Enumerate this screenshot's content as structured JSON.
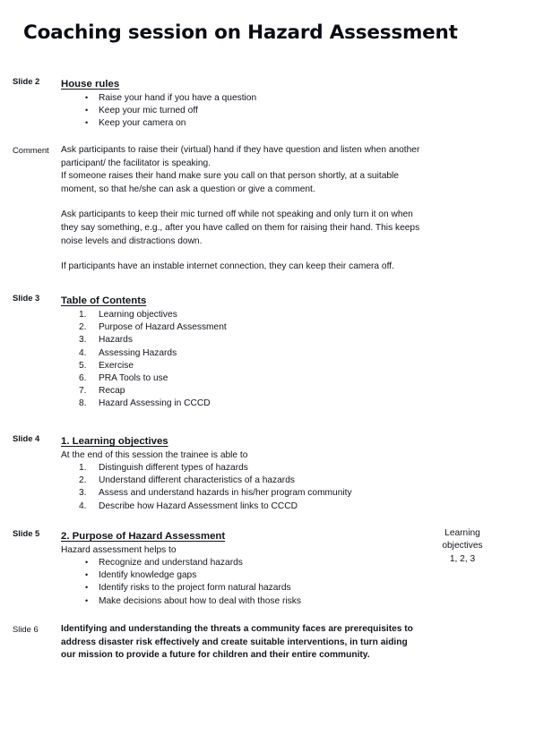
{
  "document": {
    "title": "Coaching session on Hazard Assessment"
  },
  "sections": {
    "house_rules": {
      "slide_label": "Slide 2",
      "heading": "House rules",
      "bullet_mark": "•",
      "bullets": [
        "Raise your hand if you have a question",
        "Keep your mic turned off",
        "Keep your camera on"
      ]
    },
    "comment": {
      "slide_label": "Comment",
      "paragraph_1_line_1": "Ask participants to raise their (virtual) hand if they have question and listen when another",
      "paragraph_1_line_2": "participant/ the facilitator is speaking.",
      "paragraph_1_line_3": "If someone raises their hand make sure you call on that person shortly, at a suitable",
      "paragraph_1_line_4": "moment, so that he/she can ask a question or give a comment.",
      "paragraph_2_line_1": "Ask participants to keep their mic turned off while not speaking and only turn it on when",
      "paragraph_2_line_2": "they say something, e.g., after you have called on them for raising their hand. This keeps",
      "paragraph_2_line_3": "noise levels and distractions down.",
      "paragraph_3": "If participants have an instable internet connection, they can keep their camera off."
    },
    "table_of_contents": {
      "slide_label": "Slide 3",
      "heading": "Table of Contents",
      "items": [
        {
          "num": "1.",
          "label": "Learning objectives"
        },
        {
          "num": "2.",
          "label": "Purpose of Hazard Assessment"
        },
        {
          "num": "3.",
          "label": "Hazards"
        },
        {
          "num": "4.",
          "label": "Assessing Hazards"
        },
        {
          "num": "5.",
          "label": "Exercise"
        },
        {
          "num": "6.",
          "label": "PRA Tools to use"
        },
        {
          "num": "7.",
          "label": "Recap"
        },
        {
          "num": "8.",
          "label": "Hazard Assessing in CCCD"
        }
      ]
    },
    "learning_objectives": {
      "slide_label": "Slide 4",
      "heading": "1. Learning objectives",
      "intro": "At the end of this session the trainee is able to",
      "items": [
        {
          "num": "1.",
          "label": "Distinguish different types of hazards"
        },
        {
          "num": "2.",
          "label": "Understand different characteristics of a hazards"
        },
        {
          "num": "3.",
          "label": "Assess and understand hazards in his/her program community"
        },
        {
          "num": "4.",
          "label": "Describe how Hazard Assessment links to CCCD"
        }
      ]
    },
    "purpose": {
      "slide_label": "Slide 5",
      "heading": "2. Purpose of Hazard Assessment",
      "intro": "Hazard assessment helps to",
      "bullet_mark": "•",
      "bullets": [
        "Recognize and understand hazards",
        "Identify knowledge gaps",
        "Identify risks to the project form natural hazards",
        "Make decisions about how to deal with those risks"
      ],
      "margin_note_line_1": "Learning",
      "margin_note_line_2": "objectives",
      "margin_note_line_3": "1, 2, 3"
    },
    "closing": {
      "slide_label": "Slide 6",
      "line_1": "Identifying and understanding the threats a community faces are prerequisites to",
      "line_2": "address disaster risk effectively and create suitable interventions, in turn aiding",
      "line_3": "our mission to provide a future for children and their entire community."
    }
  }
}
